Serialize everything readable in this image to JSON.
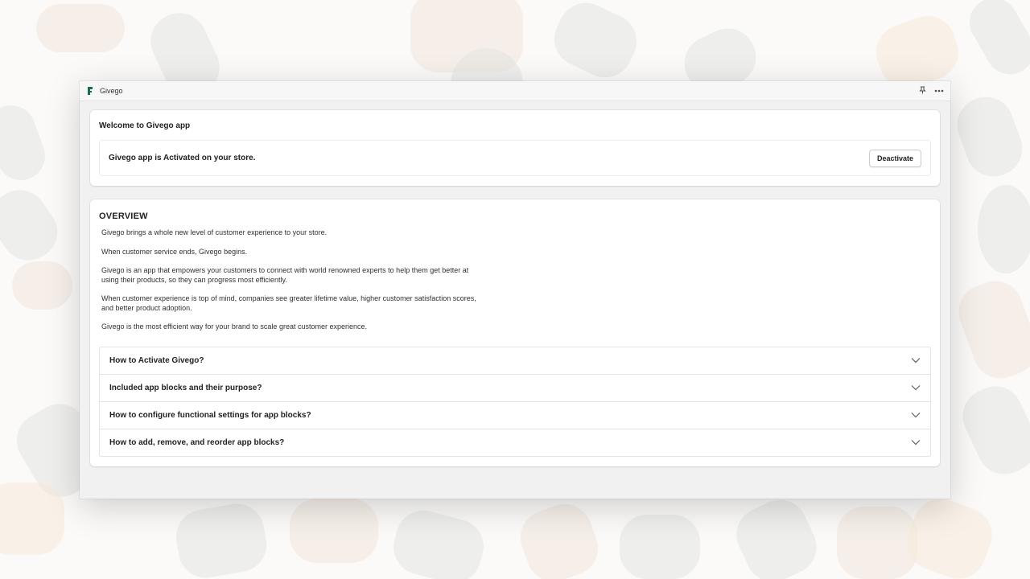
{
  "window": {
    "title": "Givego"
  },
  "welcome": {
    "title": "Welcome to Givego app",
    "status_text": "Givego app is Activated on your store.",
    "deactivate_label": "Deactivate"
  },
  "overview": {
    "title": "OVERVIEW",
    "paragraphs": [
      "Givego brings a whole new level of customer experience to your store.",
      "When customer service ends, Givego begins.",
      "Givego is an app that empowers your customers to connect with world renowned experts to help them get better at using their products, so they can progress most efficiently.",
      "When customer experience is top of mind, companies see greater lifetime value, higher customer satisfaction scores, and better product adoption.",
      "Givego is the most efficient way for your brand to scale great customer experience."
    ],
    "faq": [
      {
        "question": "How to Activate Givego?",
        "icon": "chevron-down-icon"
      },
      {
        "question": "Included app blocks and their purpose?",
        "icon": "chevron-down-icon"
      },
      {
        "question": "How to configure functional settings for app blocks?",
        "icon": "chevron-down-icon"
      },
      {
        "question": "How to add, remove, and reorder app blocks?",
        "icon": "chevron-down-icon"
      }
    ]
  },
  "icons": {
    "logo": "givego-logo-icon",
    "pin": "pin-icon",
    "more": "more-actions-icon"
  },
  "colors": {
    "brand": "#1b6b4a",
    "page_background": "#f1f1f1",
    "card_background": "#ffffff"
  }
}
